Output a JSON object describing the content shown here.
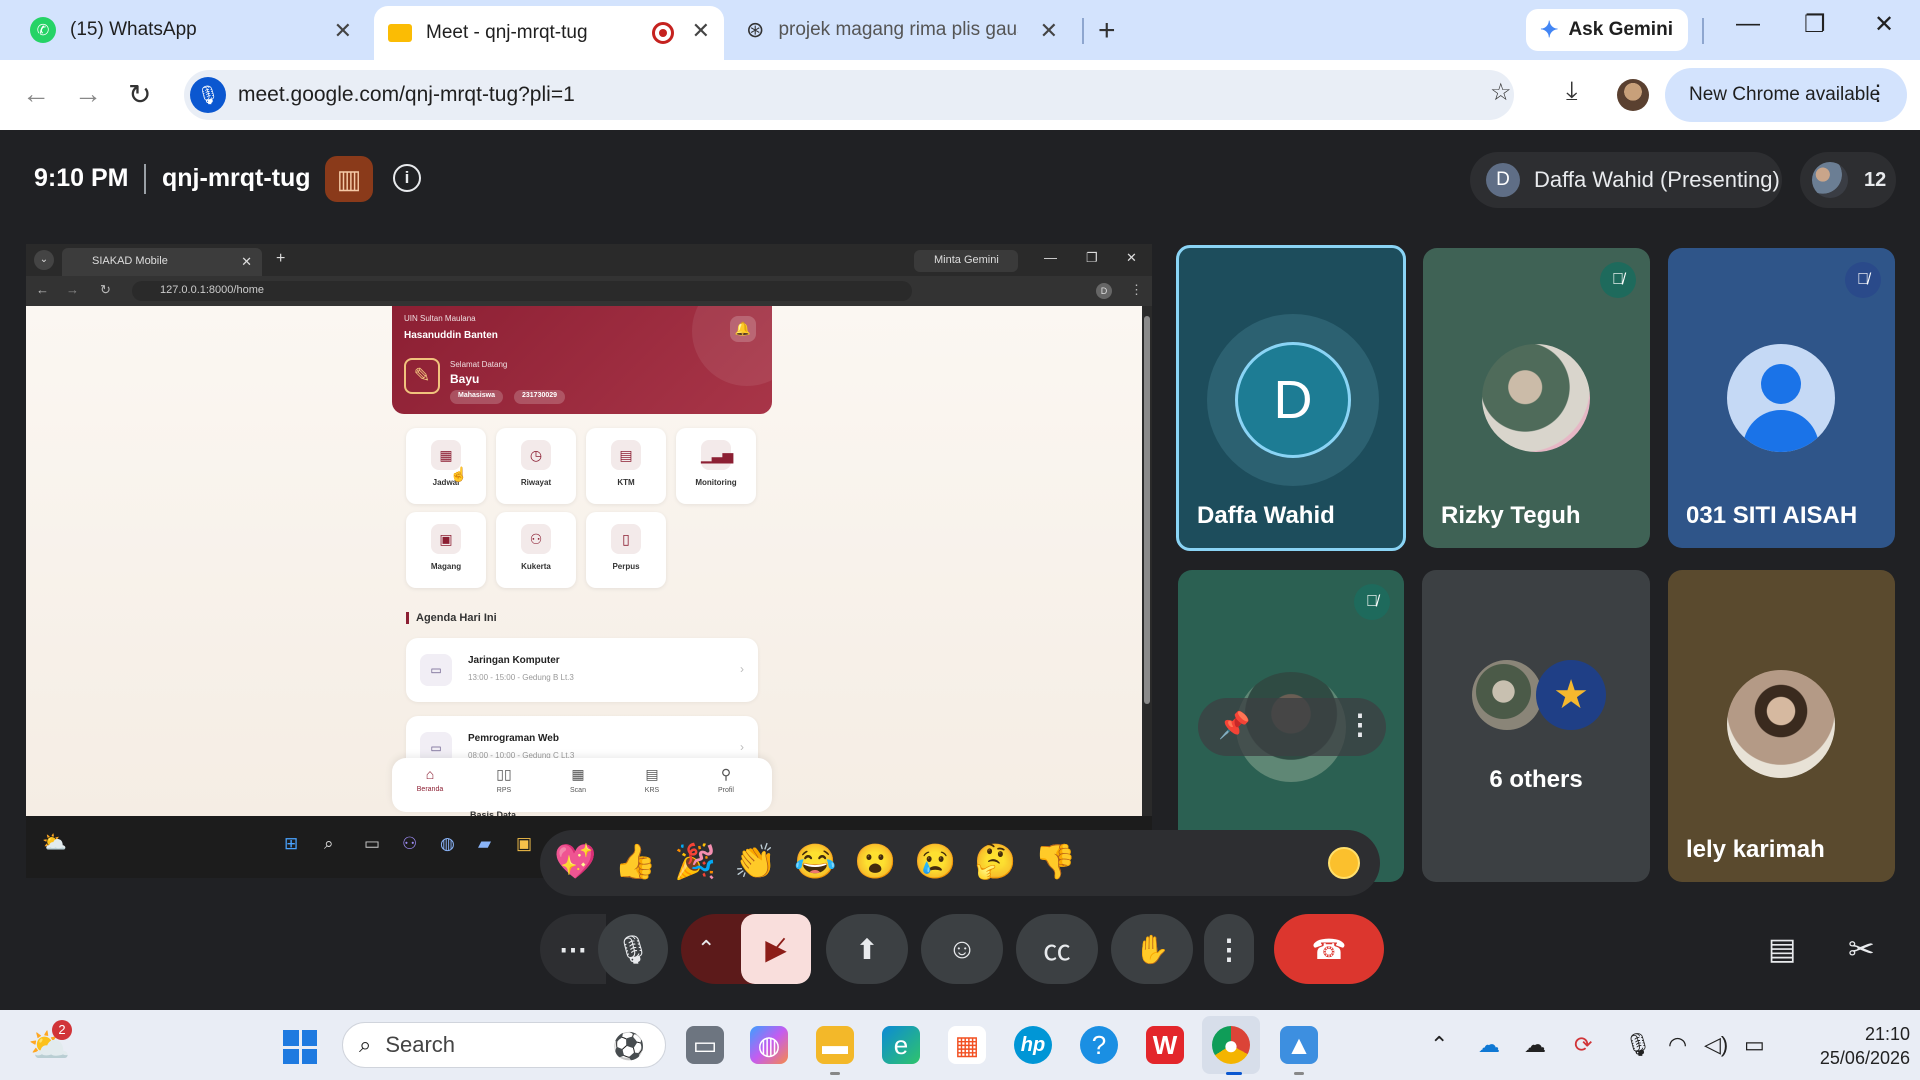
{
  "browser": {
    "tabs": [
      {
        "title": "(15) WhatsApp",
        "icon": "whatsapp-icon"
      },
      {
        "title": "Meet - qnj-mrqt-tug",
        "icon": "google-meet-icon",
        "active": true
      },
      {
        "title": "projek magang rima plis gausa",
        "icon": "chatgpt-icon"
      }
    ],
    "ask_gemini": "Ask Gemini",
    "url": "meet.google.com/qnj-mrqt-tug?pli=1",
    "new_chrome": "New Chrome available"
  },
  "meet": {
    "time": "9:10 PM",
    "code": "qnj-mrqt-tug",
    "presenting": "Daffa Wahid (Presenting)",
    "presenting_initial": "D",
    "participant_count": "12",
    "participants": [
      {
        "name": "Daffa Wahid",
        "initial": "D",
        "speaking": true
      },
      {
        "name": "Rizky Teguh",
        "muted": true
      },
      {
        "name": "031 SITI AISAH",
        "muted": true
      },
      {
        "name": "",
        "muted": true
      },
      {
        "name": "6 others"
      },
      {
        "name": "lely karimah"
      }
    ],
    "reactions": [
      "💖",
      "👍",
      "🎉",
      "👏",
      "😂",
      "😮",
      "😢",
      "🤔",
      "👎"
    ],
    "colors": {
      "leave": "#dc362e",
      "camera_off": "#f9dedc",
      "speaking_border": "#8ad4f5"
    }
  },
  "shared_screen": {
    "tab_title": "SIAKAD Mobile",
    "gemini": "Minta Gemini",
    "url": "127.0.0.1:8000/home",
    "app": {
      "uni_line1": "UIN Sultan Maulana",
      "uni_line2": "Hasanuddin Banten",
      "welcome": "Selamat Datang",
      "username": "Bayu",
      "role": "Mahasiswa",
      "nim": "231730029",
      "menu": [
        "Jadwal",
        "Riwayat",
        "KTM",
        "Monitoring",
        "Magang",
        "Kukerta",
        "Perpus"
      ],
      "agenda_title": "Agenda Hari Ini",
      "agenda": [
        {
          "name": "Jaringan Komputer",
          "time": "13:00 - 15:00 - Gedung B Lt.3"
        },
        {
          "name": "Pemrograman Web",
          "time": "08:00 - 10:00 - Gedung C Lt.3"
        }
      ],
      "next_item_partial": "Basis Data",
      "bottom_nav": [
        "Beranda",
        "RPS",
        "Scan",
        "KRS",
        "Profil"
      ]
    }
  },
  "taskbar": {
    "search_placeholder": "Search",
    "weather_badge": "2",
    "time": "21:10",
    "date": "25/06/2026"
  }
}
